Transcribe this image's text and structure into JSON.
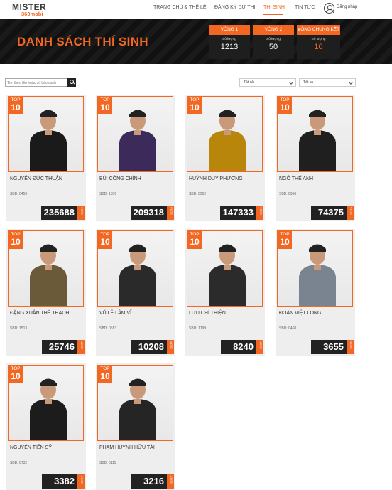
{
  "header": {
    "logo_main": "MISTER",
    "logo_sub": "360mobi",
    "nav": [
      {
        "label": "TRANG CHỦ & THỂ LỆ"
      },
      {
        "label": "ĐĂNG KÝ DỰ THI"
      },
      {
        "label": "THÍ SINH"
      },
      {
        "label": "TIN TỨC"
      }
    ],
    "active_nav": "THÍ SINH",
    "login_label": "Đăng nhập",
    "user_icon": "user-circle-icon"
  },
  "banner": {
    "title": "DANH SÁCH THÍ SINH",
    "rounds": [
      {
        "label": "VÒNG 1",
        "sub": "Số lượng",
        "value": "1213"
      },
      {
        "label": "VÒNG 2",
        "sub": "Số lượng",
        "value": "50"
      },
      {
        "label": "VÒNG CHUNG KẾT",
        "sub": "Số lượng",
        "value": "10"
      }
    ]
  },
  "filters": {
    "search_placeholder": "Tìm theo tên hoặc số báo danh",
    "search_icon": "search-icon",
    "select_1": "Tất cả",
    "select_2": "Tất cả"
  },
  "badge": {
    "line1": "TOP",
    "line2": "10"
  },
  "vote_label": "VOTE",
  "accent_color": "#f26722",
  "contestants": [
    {
      "name": "NGUYỄN ĐỨC THUẬN",
      "sbd": "SBD: 0459",
      "votes": "235688"
    },
    {
      "name": "BÙI CÔNG CHÍNH",
      "sbd": "SBD: 1376",
      "votes": "209318"
    },
    {
      "name": "HUỲNH DUY PHƯƠNG",
      "sbd": "SBD: 0952",
      "votes": "147333"
    },
    {
      "name": "NGÔ THẾ ANH",
      "sbd": "SBD: 0950",
      "votes": "74375"
    },
    {
      "name": "ĐẶNG XUÂN THẾ THẠCH",
      "sbd": "SBD: 1513",
      "votes": "25746"
    },
    {
      "name": "VŨ LÊ LÂM VĨ",
      "sbd": "SBD: 0553",
      "votes": "10208"
    },
    {
      "name": "LƯU CHÍ THIỆN",
      "sbd": "SBD: 1799",
      "votes": "8240"
    },
    {
      "name": "ĐOÀN VIỆT LONG",
      "sbd": "SBD: 0468",
      "votes": "3655"
    },
    {
      "name": "NGUYỄN TIẾN SỸ",
      "sbd": "SBD: 0732",
      "votes": "3382"
    },
    {
      "name": "PHẠM HUỲNH HỮU TÀI",
      "sbd": "SBD: 0111",
      "votes": "3216"
    }
  ]
}
